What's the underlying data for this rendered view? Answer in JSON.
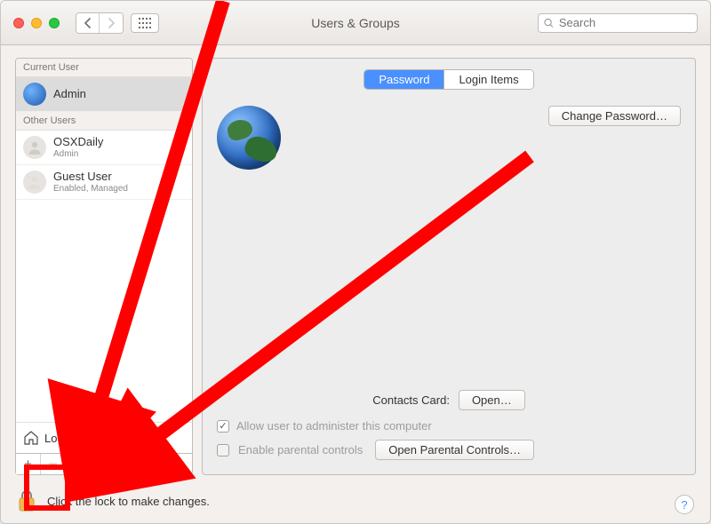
{
  "window": {
    "title": "Users & Groups"
  },
  "search": {
    "placeholder": "Search"
  },
  "sidebar": {
    "sections": [
      {
        "header": "Current User",
        "users": [
          {
            "name": "Admin",
            "sub": "",
            "avatar": "earth",
            "selected": true
          }
        ]
      },
      {
        "header": "Other Users",
        "users": [
          {
            "name": "OSXDaily",
            "sub": "Admin",
            "avatar": "person"
          },
          {
            "name": "Guest User",
            "sub": "Enabled, Managed",
            "avatar": "person"
          }
        ]
      }
    ],
    "login_options": "Login Options"
  },
  "tabs": {
    "password": "Password",
    "login_items": "Login Items",
    "active": "password"
  },
  "main": {
    "change_password": "Change Password…",
    "contacts_label": "Contacts Card:",
    "open_button": "Open…",
    "admin_checkbox": "Allow user to administer this computer",
    "parental_checkbox": "Enable parental controls",
    "parental_button": "Open Parental Controls…"
  },
  "footer": {
    "lock_text": "Click the lock to make changes."
  },
  "colors": {
    "accent": "#4a90ff",
    "red": "#ff0000"
  }
}
